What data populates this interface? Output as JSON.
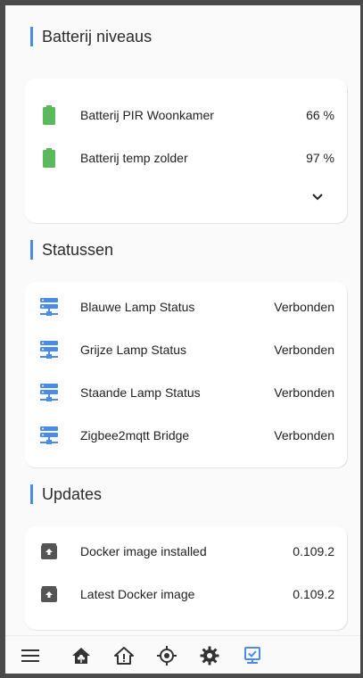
{
  "sections": {
    "battery": {
      "title": "Batterij niveaus",
      "rows": [
        {
          "label": "Batterij PIR Woonkamer",
          "value": "66 %",
          "icon": "battery-icon"
        },
        {
          "label": "Batterij temp zolder",
          "value": "97 %",
          "icon": "battery-icon"
        }
      ],
      "expand_icon": "chevron-down-icon"
    },
    "status": {
      "title": "Statussen",
      "rows": [
        {
          "label": "Blauwe Lamp Status",
          "value": "Verbonden",
          "icon": "server-network-icon"
        },
        {
          "label": "Grijze Lamp Status",
          "value": "Verbonden",
          "icon": "server-network-icon"
        },
        {
          "label": "Staande Lamp Status",
          "value": "Verbonden",
          "icon": "server-network-icon"
        },
        {
          "label": "Zigbee2mqtt Bridge",
          "value": "Verbonden",
          "icon": "server-network-icon"
        }
      ]
    },
    "updates": {
      "title": "Updates",
      "rows": [
        {
          "label": "Docker image installed",
          "value": "0.109.2",
          "icon": "package-up-icon"
        },
        {
          "label": "Latest Docker image",
          "value": "0.109.2",
          "icon": "package-up-icon"
        }
      ]
    }
  },
  "bottom_nav": {
    "items": [
      {
        "icon": "menu-icon"
      },
      {
        "icon": "home-flower-icon"
      },
      {
        "icon": "home-outline-icon"
      },
      {
        "icon": "crosshairs-icon"
      },
      {
        "icon": "gear-icon"
      },
      {
        "icon": "monitor-check-icon",
        "active": true
      }
    ]
  },
  "colors": {
    "accent": "#4a8ae8",
    "battery_green": "#5cb85c",
    "status_blue": "#4a8ae8",
    "update_icon": "#555555"
  }
}
